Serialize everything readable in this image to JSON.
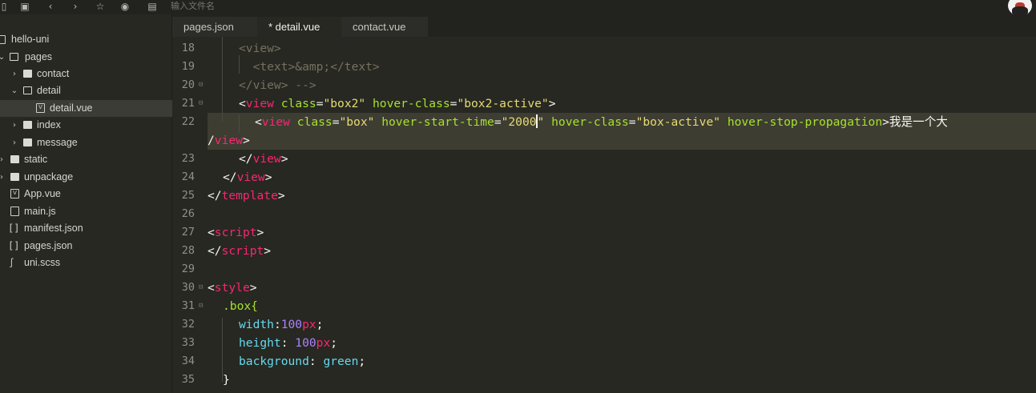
{
  "toolbar": {
    "file_search_placeholder": "输入文件名",
    "icons": [
      "menu-icon",
      "save-icon",
      "back-icon",
      "forward-icon",
      "star-icon",
      "run-icon",
      "preview-icon"
    ]
  },
  "sidebar": {
    "items": [
      {
        "label": "hello-uni"
      },
      {
        "label": "pages"
      },
      {
        "label": "contact"
      },
      {
        "label": "detail"
      },
      {
        "label": "detail.vue"
      },
      {
        "label": "index"
      },
      {
        "label": "message"
      },
      {
        "label": "static"
      },
      {
        "label": "unpackage"
      },
      {
        "label": "App.vue"
      },
      {
        "label": "main.js"
      },
      {
        "label": "manifest.json"
      },
      {
        "label": "pages.json"
      },
      {
        "label": "uni.scss"
      }
    ]
  },
  "tabs": [
    {
      "label": "pages.json"
    },
    {
      "label": "* detail.vue"
    },
    {
      "label": "contact.vue"
    }
  ],
  "editor": {
    "line_numbers": [
      "18",
      "19",
      "20",
      "21",
      "22",
      "23",
      "24",
      "25",
      "26",
      "27",
      "28",
      "29",
      "30",
      "31",
      "32",
      "33",
      "34",
      "35"
    ],
    "lines": [
      {
        "text": "<view>"
      },
      {
        "text": "  <text>&amp;</text>"
      },
      {
        "text": "</view> -->"
      },
      {
        "tag_open": "<",
        "tag": "view",
        "a1": "class",
        "v1": "\"box2\"",
        "a2": "hover-class",
        "v2": "\"box2-active\"",
        "close": ">"
      },
      {
        "tag_open": "<",
        "tag": "view",
        "a1": "class",
        "v1": "\"box\"",
        "a2": "hover-start-time",
        "v2": "\"2000",
        "v2b": "\"",
        "a3": "hover-class",
        "v3": "\"box-active\"",
        "a4": "hover-stop-propagation",
        "close": ">",
        "text": "我是一个大"
      },
      {
        "text": "/view>",
        "tag": "view"
      },
      {
        "close_tag": "view"
      },
      {
        "close_tag": "view"
      },
      {
        "close_tag": "template"
      },
      {
        "text": ""
      },
      {
        "open_tag": "script"
      },
      {
        "close_tag": "script"
      },
      {
        "text": ""
      },
      {
        "open_tag": "style"
      },
      {
        "selector": ".box{"
      },
      {
        "prop": "width",
        "value": "100px",
        "value_num": "100",
        "value_unit": "px"
      },
      {
        "prop": "height",
        "value": "100px",
        "value_num": "100",
        "value_unit": "px"
      },
      {
        "prop": "background",
        "value": "green"
      },
      {
        "text": "}"
      }
    ]
  },
  "colors": {
    "background": "#272822",
    "tag": "#f92672",
    "attribute": "#a6e22e",
    "string": "#e6db74",
    "number": "#ae81ff",
    "property": "#66d9ef",
    "comment": "#75715e"
  }
}
